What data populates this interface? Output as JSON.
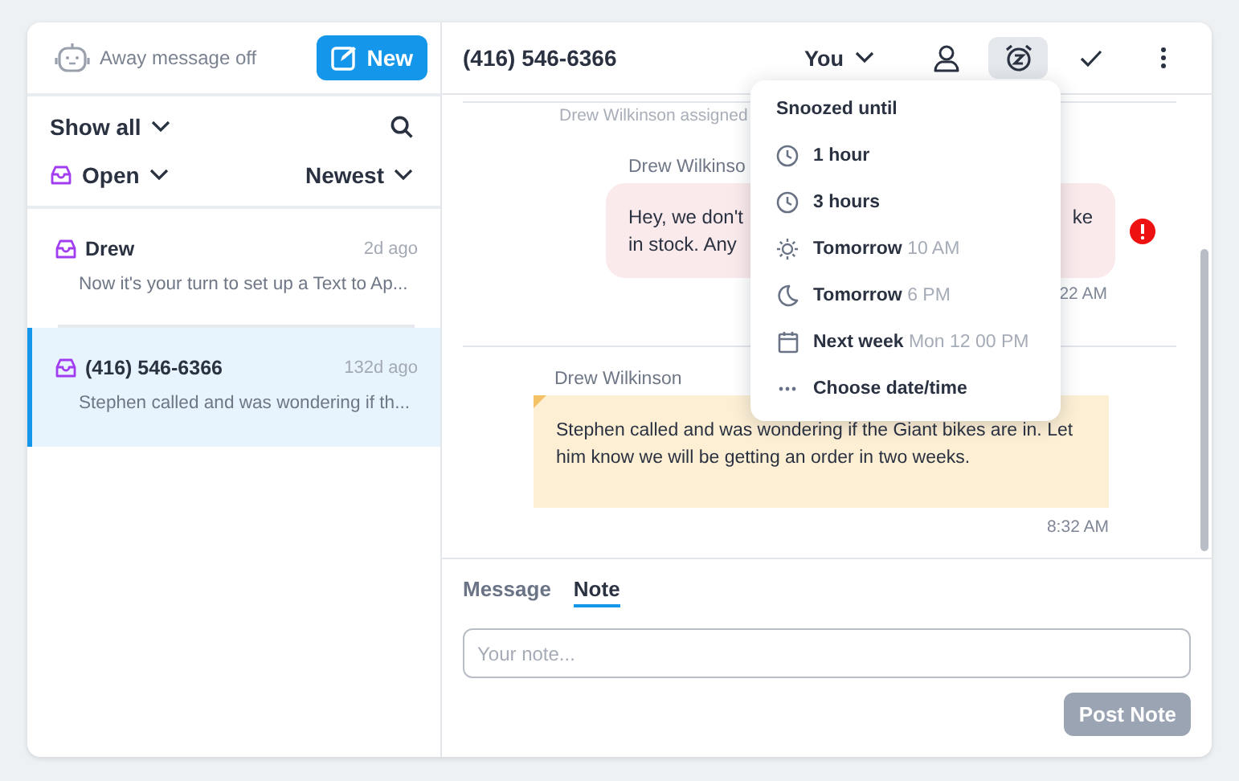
{
  "sidebar": {
    "away_status": "Away message off",
    "new_button": "New",
    "filter": "Show all",
    "status_filter": "Open",
    "sort": "Newest",
    "conversations": [
      {
        "name": "Drew",
        "time": "2d ago",
        "preview": "Now it's your turn to set up a Text to Ap...",
        "selected": false
      },
      {
        "name": "(416) 546-6366",
        "time": "132d ago",
        "preview": "Stephen called and was wondering if th...",
        "selected": true
      }
    ]
  },
  "conversation": {
    "title": "(416) 546-6366",
    "assignee": "You",
    "snooze_active": true,
    "messages": [
      {
        "kind": "event",
        "text": "Drew Wilkinson assigned"
      },
      {
        "kind": "sms",
        "sender": "Drew Wilkinso",
        "lines": [
          "Hey, we don't",
          "in stock. Any"
        ],
        "tail": "ke",
        "time": "22 AM",
        "failed": true
      },
      {
        "kind": "note",
        "sender": "Drew Wilkinson",
        "text": "Stephen called and was wondering if the Giant bikes are in. Let him know we will be getting an order in two weeks.",
        "time": "8:32 AM"
      }
    ]
  },
  "composer": {
    "tabs": [
      {
        "label": "Message",
        "selected": false
      },
      {
        "label": "Note",
        "selected": true
      }
    ],
    "placeholder": "Your note...",
    "submit": "Post Note",
    "submit_disabled": true
  },
  "snooze_menu": {
    "title": "Snoozed until",
    "options": [
      {
        "kind": "clock",
        "label": "1 hour"
      },
      {
        "kind": "clock",
        "label": "3 hours"
      },
      {
        "kind": "sun",
        "label": "Tomorrow",
        "detail": "10 AM"
      },
      {
        "kind": "moon",
        "label": "Tomorrow",
        "detail": "6 PM"
      },
      {
        "kind": "calendar",
        "label": "Next week",
        "detail": "Mon 12 00 PM"
      },
      {
        "kind": "more",
        "label": "Choose date/time"
      }
    ]
  }
}
